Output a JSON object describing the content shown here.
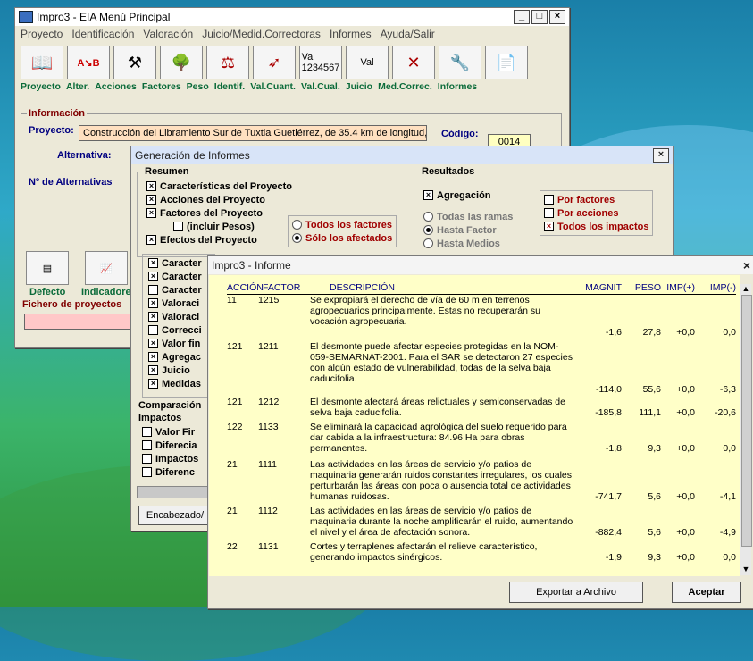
{
  "main_window": {
    "title": "Impro3 - EIA   Menú Principal",
    "menu": [
      "Proyecto",
      "Identificación",
      "Valoración",
      "Juicio/Medid.Correctoras",
      "Informes",
      "Ayuda/Salir"
    ],
    "toolbar_labels": [
      "Proyecto",
      "Alter.",
      "Acciones",
      "Factores",
      "Peso",
      "Identif.",
      "Val.Cuant.",
      "Val.Cual.",
      "Juicio",
      "Med.Correc.",
      "Informes"
    ],
    "info_group": "Información",
    "proyecto_label": "Proyecto:",
    "proyecto_value": "Construcción del Libramiento Sur de Tuxtla Guetiérrez, de 35.4 km de longitud,",
    "codigo_label": "Código:",
    "codigo_value": "0014",
    "alternativa_label": "Alternativa:",
    "n_alternativas_label": "Nº de Alternativas",
    "bottom_labels": [
      "Defecto",
      "Indicadore"
    ],
    "fichero_label": "Fichero de proyectos"
  },
  "gen_window": {
    "title": "Generación de Informes",
    "resumen_title": "Resumen",
    "resumen_items": [
      {
        "label": "Características del Proyecto",
        "checked": true
      },
      {
        "label": "Acciones del Proyecto",
        "checked": true
      },
      {
        "label": "Factores del Proyecto",
        "checked": true
      },
      {
        "label": "(incluir Pesos)",
        "checked": false
      },
      {
        "label": "Efectos del Proyecto",
        "checked": true
      }
    ],
    "radio_todos": "Todos los factores",
    "radio_solo": "Sólo los afectados",
    "resultados_title": "Resultados",
    "agregacion": "Agregación",
    "res_radios": [
      "Todas las ramas",
      "Hasta Factor",
      "Hasta Medios"
    ],
    "res_checks": [
      {
        "label": "Por factores",
        "checked": false
      },
      {
        "label": "Por acciones",
        "checked": false
      },
      {
        "label": "Todos los impactos",
        "checked": true
      }
    ],
    "list_items": [
      {
        "label": "Caracter",
        "checked": true
      },
      {
        "label": "Caracter",
        "checked": true
      },
      {
        "label": "Caracter",
        "checked": false
      },
      {
        "label": "Valoraci",
        "checked": true
      },
      {
        "label": "Valoraci",
        "checked": true
      },
      {
        "label": "Correcci",
        "checked": false
      },
      {
        "label": "Valor fin",
        "checked": true
      },
      {
        "label": "Agregac",
        "checked": true
      },
      {
        "label": "Juicio",
        "checked": true
      },
      {
        "label": "Medidas",
        "checked": true
      }
    ],
    "comparacion_title": "Comparación",
    "impactos_title": "Impactos",
    "impactos_items": [
      "Valor Fir",
      "Diferecia",
      "Impactos",
      "Diferenc"
    ],
    "encabezado_button": "Encabezado/"
  },
  "report_window": {
    "title": "Impro3 - Informe",
    "headers": {
      "accion": "ACCIÓN",
      "factor": "FACTOR",
      "descripcion": "DESCRIPCIÓN",
      "magnit": "MAGNIT",
      "peso": "PESO",
      "imp_plus": "IMP(+)",
      "imp_minus": "IMP(-)"
    },
    "rows": [
      {
        "accion": "11",
        "factor": "1215",
        "desc": "Se expropiará el derecho de vía de 60 m en terrenos agropecuarios principalmente. Estas no recuperarán su vocación agropecuaria.",
        "magnit": "-1,6",
        "peso": "27,8",
        "plus": "+0,0",
        "minus": "0,0"
      },
      {
        "accion": "121",
        "factor": "1211",
        "desc": "El desmonte puede afectar especies protegidas en la NOM-059-SEMARNAT-2001. Para el SAR se detectaron 27 especies con algún estado de vulnerabilidad, todas de la selva baja caducifolia.",
        "magnit": "-114,0",
        "peso": "55,6",
        "plus": "+0,0",
        "minus": "-6,3"
      },
      {
        "accion": "121",
        "factor": "1212",
        "desc": "El desmonte afectará áreas relictuales y semiconservadas de selva baja caducifolia.",
        "magnit": "-185,8",
        "peso": "111,1",
        "plus": "+0,0",
        "minus": "-20,6"
      },
      {
        "accion": "122",
        "factor": "1133",
        "desc": "Se eliminará la capacidad agrológica del suelo requerido para dar cabida a la infraestructura: 84.96 Ha para obras permanentes.",
        "magnit": "-1,8",
        "peso": "9,3",
        "plus": "+0,0",
        "minus": "0,0"
      },
      {
        "accion": "21",
        "factor": "1111",
        "desc": "Las actividades en las áreas de servicio y/o patios de maquinaria generarán ruidos constantes irregulares, los cuales perturbarán las áreas con poca o ausencia total de actividades humanas ruidosas.",
        "magnit": "-741,7",
        "peso": "5,6",
        "plus": "+0,0",
        "minus": "-4,1"
      },
      {
        "accion": "21",
        "factor": "1112",
        "desc": "Las actividades en las áreas de servicio y/o patios de maquinaria durante la noche amplificarán el ruido, aumentando el nivel y el área de afectación sonora.",
        "magnit": "-882,4",
        "peso": "5,6",
        "plus": "+0,0",
        "minus": "-4,9"
      },
      {
        "accion": "22",
        "factor": "1131",
        "desc": "Cortes y terraplenes afectarán el relieve característico, generando impactos sinérgicos.",
        "magnit": "-1,9",
        "peso": "9,3",
        "plus": "+0,0",
        "minus": "0,0"
      }
    ],
    "export_button": "Exportar a Archivo",
    "accept_button": "Aceptar"
  }
}
